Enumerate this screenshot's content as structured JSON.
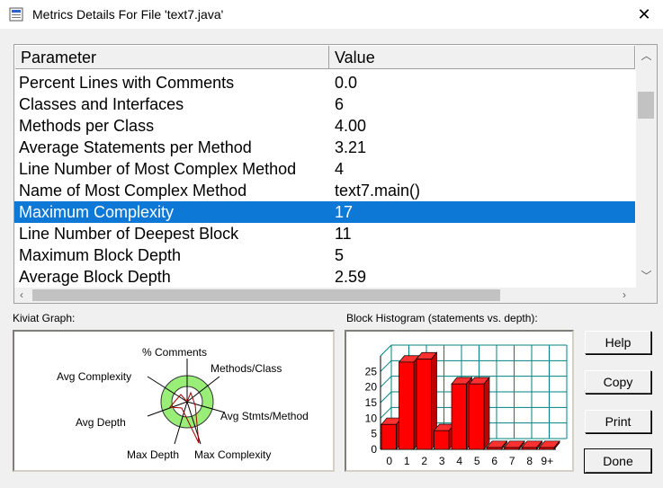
{
  "window": {
    "title": "Metrics Details For File 'text7.java'",
    "close_glyph": "✕"
  },
  "grid": {
    "columns": [
      "Parameter",
      "Value"
    ],
    "rows": [
      {
        "parameter": "Percent Lines with Comments",
        "value": "0.0"
      },
      {
        "parameter": "Classes and Interfaces",
        "value": "6"
      },
      {
        "parameter": "Methods per Class",
        "value": "4.00"
      },
      {
        "parameter": "Average Statements per Method",
        "value": "3.21"
      },
      {
        "parameter": "Line Number of Most Complex Method",
        "value": "4"
      },
      {
        "parameter": "Name of Most Complex Method",
        "value": "text7.main()"
      },
      {
        "parameter": "Maximum Complexity",
        "value": "17"
      },
      {
        "parameter": "Line Number of Deepest Block",
        "value": "11"
      },
      {
        "parameter": "Maximum Block Depth",
        "value": "5"
      },
      {
        "parameter": "Average Block Depth",
        "value": "2.59"
      }
    ],
    "selected_index": 6
  },
  "kiviat": {
    "label": "Kiviat Graph:",
    "axes": [
      "% Comments",
      "Methods/Class",
      "Avg Stmts/Method",
      "Max Complexity",
      "Max Depth",
      "Avg Depth",
      "Avg Complexity"
    ]
  },
  "histogram": {
    "label": "Block Histogram (statements vs. depth):"
  },
  "chart_data": {
    "type": "bar",
    "title": "Block Histogram (statements vs. depth):",
    "categories": [
      "0",
      "1",
      "2",
      "3",
      "4",
      "5",
      "6",
      "7",
      "8",
      "9+"
    ],
    "values": [
      8,
      28,
      29,
      6,
      21,
      21,
      0,
      0,
      0,
      0
    ],
    "ylim": [
      0,
      30
    ],
    "yticks": [
      "25",
      "20",
      "15",
      "10",
      "5",
      "0"
    ],
    "bar_color": "#ff0000",
    "grid_color": "#008080"
  },
  "buttons": {
    "help": "Help",
    "copy": "Copy",
    "print": "Print",
    "done": "Done"
  },
  "colors": {
    "selection": "#0e78d7",
    "kiviat_fill": "#99ee77"
  }
}
